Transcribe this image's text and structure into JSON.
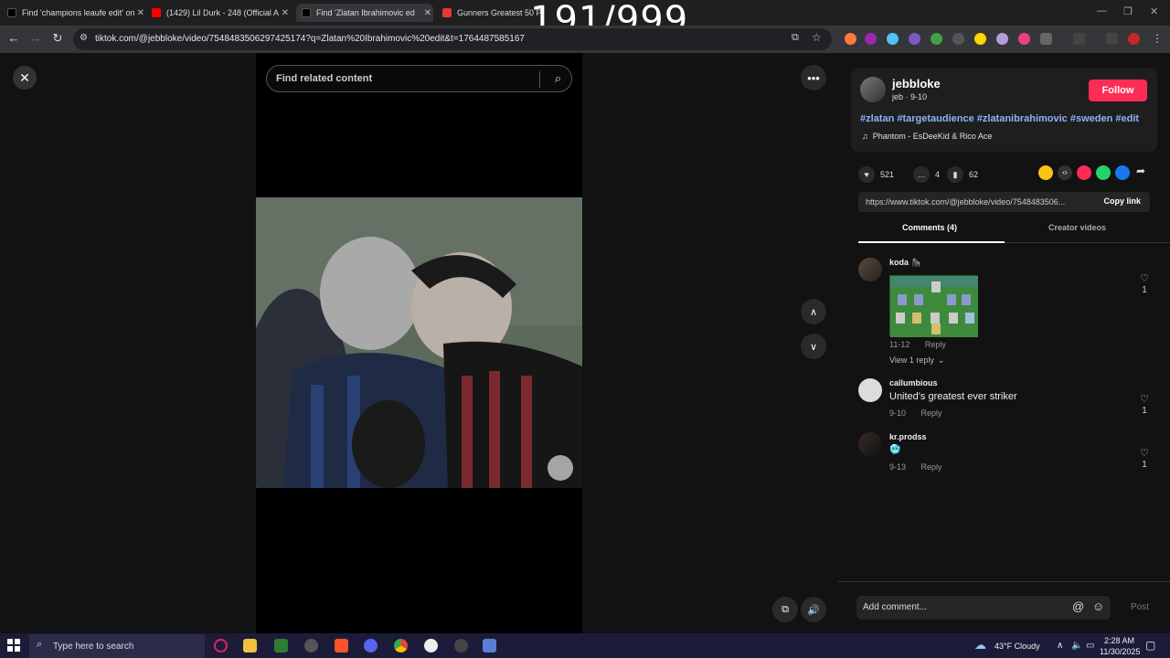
{
  "browser": {
    "tabs": [
      {
        "title": "Find 'champions leaufe edit' on",
        "color": "#000000"
      },
      {
        "title": "(1429) Lil Durk - 248 (Official A",
        "color": "#ff0000"
      },
      {
        "title": "Find 'Zlatan Ibrahimovic ed",
        "color": "#000000"
      },
      {
        "title": "Gunners Greatest 50 P",
        "color": "#e53935"
      }
    ],
    "url": "tiktok.com/@jebbloke/video/7548483506297425174?q=Zlatan%20Ibrahimovic%20edit&t=1764487585167",
    "overlay_counter": "191/999"
  },
  "video": {
    "search_placeholder": "Find related content"
  },
  "creator": {
    "username": "jebbloke",
    "subline": "jeb · 9-10",
    "follow_label": "Follow",
    "hashtags": "#zlatan #targetaudience #zlatanibrahimovic #sweden #edit",
    "music": "Phantom - EsDeeKid & Rico Ace"
  },
  "stats": {
    "likes": "521",
    "comments": "4",
    "saves": "62"
  },
  "link": {
    "url": "https://www.tiktok.com/@jebbloke/video/7548483506...",
    "copy_label": "Copy link"
  },
  "panel_tabs": {
    "comments": "Comments (4)",
    "creator_videos": "Creator videos"
  },
  "comments": [
    {
      "user": "koda 🦍",
      "text": "",
      "date": "11-12",
      "reply": "Reply",
      "likes": "1",
      "view_replies": "View 1 reply"
    },
    {
      "user": "callumbious",
      "text": "United's greatest ever striker",
      "date": "9-10",
      "reply": "Reply",
      "likes": "1"
    },
    {
      "user": "kr.prodss",
      "text": "🥶",
      "date": "9-13",
      "reply": "Reply",
      "likes": "1"
    }
  ],
  "comment_bar": {
    "placeholder": "Add comment...",
    "post_label": "Post"
  },
  "taskbar": {
    "search_placeholder": "Type here to search",
    "weather": "43°F  Cloudy",
    "time": "2:28 AM",
    "date": "11/30/2025"
  },
  "colors": {
    "accent": "#fe2c55",
    "hashtag": "#8ab4f8"
  }
}
